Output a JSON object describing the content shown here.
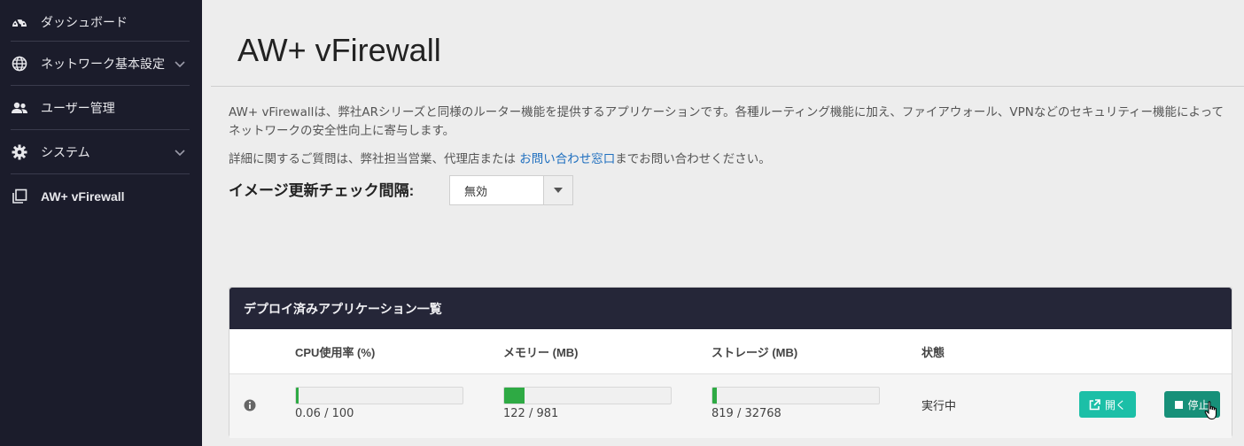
{
  "sidebar": {
    "items": [
      {
        "label": "ダッシュボード",
        "icon": "speedometer-icon"
      },
      {
        "label": "ネットワーク基本設定",
        "icon": "globe-icon",
        "expandable": true
      },
      {
        "label": "ユーザー管理",
        "icon": "users-icon"
      },
      {
        "label": "システム",
        "icon": "gear-icon",
        "expandable": true
      },
      {
        "label": "AW+ vFirewall",
        "icon": "windows-icon"
      }
    ]
  },
  "page": {
    "title": "AW+ vFirewall",
    "description": "AW+ vFirewallは、弊社ARシリーズと同様のルーター機能を提供するアプリケーションです。各種ルーティング機能に加え、ファイアウォール、VPNなどのセキュリティー機能によってネットワークの安全性向上に寄与します。",
    "contact_prefix": "詳細に関するご質問は、弊社担当営業、代理店または ",
    "contact_link": "お問い合わせ窓口",
    "contact_suffix": "までお問い合わせください。",
    "image_check_label": "イメージ更新チェック間隔:",
    "image_check_value": "無効"
  },
  "panel": {
    "title": "デプロイ済みアプリケーション一覧",
    "columns": {
      "cpu": "CPU使用率 (%)",
      "memory": "メモリー (MB)",
      "storage": "ストレージ (MB)",
      "status": "状態"
    },
    "row": {
      "cpu_text": "0.06 / 100",
      "cpu_fraction": 0.0006,
      "memory_text": "122 / 981",
      "memory_fraction": 0.124,
      "storage_text": "819 / 32768",
      "storage_fraction": 0.025,
      "status": "実行中",
      "open_label": "開く",
      "stop_label": "停止"
    }
  },
  "colors": {
    "sidebar_bg": "#1b1c2b",
    "panel_header_bg": "#252638",
    "bar_fill": "#2eaa44",
    "open_button": "#1cbfa7",
    "stop_button": "#179079",
    "link": "#1f6fbf"
  }
}
